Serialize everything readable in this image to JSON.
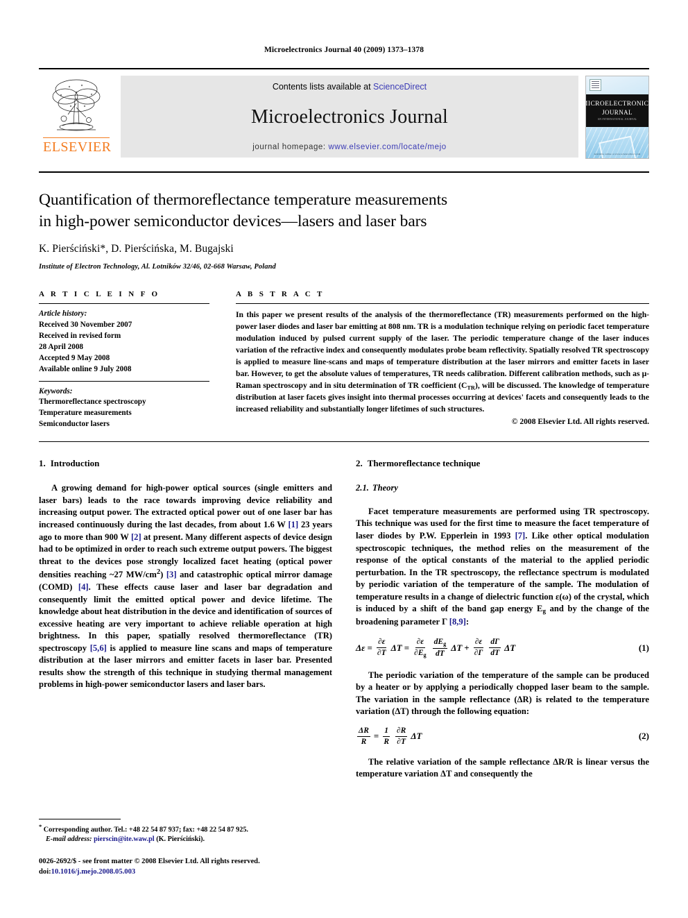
{
  "running_head": "Microelectronics Journal 40 (2009) 1373–1378",
  "banner": {
    "contents_prefix": "Contents lists available at ",
    "sciencedirect": "ScienceDirect",
    "journal_name": "Microelectronics Journal",
    "homepage_prefix": "journal homepage: ",
    "homepage_url": "www.elsevier.com/locate/mejo",
    "publisher": "ELSEVIER",
    "cover_title_line1": "Microelectronics",
    "cover_title_line2": "Journal",
    "cover_title_line3": "An international journal",
    "cover_footer": "Available online at www.sciencedirect.com",
    "link_color": "#3b3bb5"
  },
  "article": {
    "title_line1": "Quantification of thermoreflectance temperature measurements",
    "title_line2": "in high-power semiconductor devices—lasers and laser bars",
    "authors": "K. Pierściński*, D. Pierścińska, M. Bugajski",
    "affiliation": "Institute of Electron Technology, Al. Lotników 32/46, 02-668 Warsaw, Poland"
  },
  "info": {
    "heading": "A R T I C L E   I N F O",
    "history_label": "Article history:",
    "history": [
      "Received 30 November 2007",
      "Received in revised form",
      "28 April 2008",
      "Accepted 9 May 2008",
      "Available online 9 July 2008"
    ],
    "keywords_label": "Keywords:",
    "keywords": [
      "Thermoreflectance spectroscopy",
      "Temperature measurements",
      "Semiconductor lasers"
    ]
  },
  "abstract": {
    "heading": "A B S T R A C T",
    "text": "In this paper we present results of the analysis of the thermoreflectance (TR) measurements performed on the high-power laser diodes and laser bar emitting at 808 nm. TR is a modulation technique relying on periodic facet temperature modulation induced by pulsed current supply of the laser. The periodic temperature change of the laser induces variation of the refractive index and consequently modulates probe beam reflectivity. Spatially resolved TR spectroscopy is applied to measure line-scans and maps of temperature distribution at the laser mirrors and emitter facets in laser bar. However, to get the absolute values of temperatures, TR needs calibration. Different calibration methods, such as μ-Raman spectroscopy and in situ determination of TR coefficient (C",
    "text_sub": "TR",
    "text_tail": "), will be discussed. The knowledge of temperature distribution at laser facets gives insight into thermal processes occurring at devices' facets and consequently leads to the increased reliability and substantially longer lifetimes of such structures.",
    "copyright": "© 2008 Elsevier Ltd. All rights reserved."
  },
  "sections": {
    "intro_num": "1.",
    "intro_title": "Introduction",
    "intro_p1_a": "A growing demand for high-power optical sources (single emitters and laser bars) leads to the race towards improving device reliability and increasing output power. The extracted optical power out of one laser bar has increased continuously during the last decades, from about 1.6 W ",
    "intro_ref1": "[1]",
    "intro_p1_b": " 23 years ago to more than 900 W ",
    "intro_ref2": "[2]",
    "intro_p1_c": " at present. Many different aspects of device design had to be optimized in order to reach such extreme output powers. The biggest threat to the devices pose strongly localized facet heating (optical power densities reaching ~27 MW/cm",
    "intro_sup": "2",
    "intro_p1_d": ") ",
    "intro_ref3": "[3]",
    "intro_p1_e": " and catastrophic optical mirror damage (COMD) ",
    "intro_ref4": "[4]",
    "intro_p1_f": ". These effects cause laser and laser bar degradation and consequently limit the emitted optical power and device lifetime. The knowledge about heat distribution in the device and identification of sources of excessive heating are very important to achieve reliable operation at high brightness. In this paper, spatially resolved thermoreflectance (TR) spectroscopy ",
    "intro_ref5": "[5,6]",
    "intro_p1_g": " is applied to measure line scans and maps of temperature distribution at the laser mirrors and emitter facets in laser bar. Presented results show the strength of this technique in studying thermal management problems in high-power semiconductor lasers and laser bars.",
    "tech_num": "2.",
    "tech_title": "Thermoreflectance technique",
    "theory_num": "2.1.",
    "theory_title": "Theory",
    "theory_p1_a": "Facet temperature measurements are performed using TR spectroscopy. This technique was used for the first time to measure the facet temperature of laser diodes by P.W. Epperlein in 1993 ",
    "theory_ref7": "[7]",
    "theory_p1_b": ". Like other optical modulation spectroscopic techniques, the method relies on the measurement of the response of the optical constants of the material to the applied periodic perturbation. In the TR spectroscopy, the reflectance spectrum is modulated by periodic variation of the temperature of the sample. The modulation of temperature results in a change of dielectric function ε(ω) of the crystal, which is induced by a shift of the band gap energy E",
    "theory_sub_g": "g",
    "theory_p1_c": " and by the change of the broadening parameter Γ ",
    "theory_ref89": "[8,9]",
    "theory_p1_d": ":",
    "p_after_eq1": "The periodic variation of the temperature of the sample can be produced by a heater or by applying a periodically chopped laser beam to the sample. The variation in the sample reflectance (ΔR) is related to the temperature variation (ΔT) through the following equation:",
    "p_after_eq2": "The relative variation of the sample reflectance ΔR/R is linear versus the temperature variation ΔT and consequently the"
  },
  "equations": {
    "eq1_number": "(1)",
    "eq1_lhs": "Δε",
    "eq1_eq": "=",
    "eq1_f1_num": "∂ε",
    "eq1_f1_den": "∂T",
    "eq1_t1": "ΔT",
    "eq1_eq2": "=",
    "eq1_f2_num": "∂ε",
    "eq1_f2_den": "∂E",
    "eq1_f2_den_sub": "g",
    "eq1_f3_num": "dE",
    "eq1_f3_num_sub": "g",
    "eq1_f3_den": "dT",
    "eq1_t2": "ΔT",
    "eq1_plus": "+",
    "eq1_f4_num": "∂ε",
    "eq1_f4_den": "∂Γ",
    "eq1_f5_num": "dΓ",
    "eq1_f5_den": "dT",
    "eq1_t3": "ΔT",
    "eq2_number": "(2)",
    "eq2_f1_num": "ΔR",
    "eq2_f1_den": "R",
    "eq2_eq": "=",
    "eq2_f2_num": "1",
    "eq2_f2_den": "R",
    "eq2_f3_num": "∂R",
    "eq2_f3_den": "∂T",
    "eq2_t1": "ΔT"
  },
  "footnote": {
    "marker": "*",
    "corresponding": " Corresponding author. Tel.: +48 22 54 87 937; fax: +48 22 54 87 925.",
    "email_label": "E-mail address:",
    "email": "pierscin@ite.waw.pl",
    "email_owner": "(K. Pierściński)."
  },
  "imprint": {
    "line1": "0026-2692/$ - see front matter © 2008 Elsevier Ltd. All rights reserved.",
    "doi_label": "doi:",
    "doi": "10.1016/j.mejo.2008.05.003"
  }
}
